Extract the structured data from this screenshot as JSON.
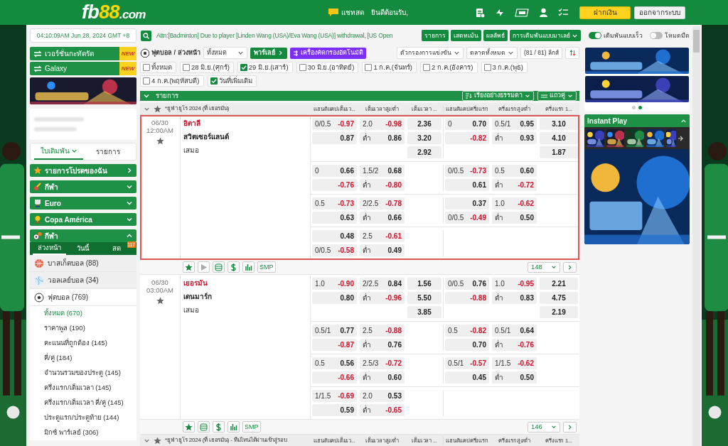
{
  "header": {
    "logo": [
      "fb",
      "88",
      ".com"
    ],
    "chat": "แชทสด",
    "welcome": "ยินดีต้อนรับ,",
    "buttons": [
      {
        "label": "ฝากเงิน",
        "kind": "primary"
      },
      {
        "label": "ออกจากระบบ",
        "kind": "secondary"
      }
    ]
  },
  "top_bar": {
    "clock": "04:10:09AM Jun 28, 2024 GMT +8",
    "announcement": "Attn:[Badminton] Due to player [Linden Wang (USA)/Eva Wang (USA)] withdrawal, [US Open",
    "buttons": [
      "รายการ",
      "เสตทเม้น",
      "ผลลัพธ์"
    ],
    "odds_type": "การเดิมพันแบบมาเลย์",
    "toggles": [
      {
        "label": "เดิมพันแบบเร็ว",
        "on": true
      },
      {
        "label": "โหมดมืด",
        "on": false
      }
    ]
  },
  "sidebar": {
    "versions": [
      {
        "label": "เวอร์ชั่นกะทัดรัด",
        "badge": "NEW"
      },
      {
        "label": "Galaxy",
        "badge": "NEW"
      }
    ],
    "tabs": [
      {
        "label": "ใบเดิมพัน",
        "selected": true
      },
      {
        "label": "รายการ",
        "selected": false
      }
    ],
    "sections": [
      {
        "label": "รายการโปรดของฉัน",
        "kind": "favorites"
      },
      {
        "label": "กีฬา",
        "kind": "sports",
        "expanded": false
      },
      {
        "label": "Euro",
        "kind": "euro",
        "expanded": false
      },
      {
        "label": "Copa América",
        "kind": "copa",
        "expanded": false
      },
      {
        "label": "กีฬา",
        "kind": "balls",
        "expanded": true
      }
    ],
    "sport_tabs": [
      {
        "label": "ล่วงหน้า",
        "selected": true
      },
      {
        "label": "วันนี้",
        "selected": false
      },
      {
        "label": "สด",
        "selected": false,
        "badge": "117"
      }
    ],
    "sports": [
      {
        "name": "บาสเก็ตบอล",
        "count": "(88)",
        "kind": "basketball",
        "expanded": false
      },
      {
        "name": "วอลเลย์บอล",
        "count": "(34)",
        "kind": "volleyball",
        "expanded": false
      },
      {
        "name": "ฟุตบอล",
        "count": "(769)",
        "kind": "soccer",
        "expanded": true,
        "children": [
          {
            "label": "ทั้งหมด",
            "count": "(670)",
            "selected": true
          },
          {
            "label": "ราคาพูล",
            "count": "(190)",
            "selected": false
          },
          {
            "label": "คะแนนที่ถูกต้อง",
            "count": "(145)",
            "selected": false
          },
          {
            "label": "คี่/คู่",
            "count": "(184)",
            "selected": false
          },
          {
            "label": "จำนวนรวมของประตู",
            "count": "(145)",
            "selected": false
          },
          {
            "label": "ครึ่งแรก/เต็มเวลา",
            "count": "(145)",
            "selected": false
          },
          {
            "label": "ครึ่งแรก/เต็มเวลา คี่/คู่",
            "count": "(145)",
            "selected": false
          },
          {
            "label": "ประตูแรก/ประตูท้าย",
            "count": "(144)",
            "selected": false
          },
          {
            "label": "มิกซ์ พาร์เลย์",
            "count": "(306)",
            "selected": false
          }
        ]
      }
    ]
  },
  "filters": {
    "sport": "ฟุตบอล / ล่วงหน้า",
    "select": "ทั้งหมด",
    "parlay": "พาร์เลย์",
    "auto_filter": "เครื่องคัดกรองอัตโนมัติ",
    "dropdowns": [
      "ตัวกรองการแข่งขัน",
      "ตลาดทั้งหมด"
    ],
    "league_count": "(81 / 81) ลีกส์",
    "dates": [
      {
        "label": "ทั้งหมด",
        "checked": false
      },
      {
        "label": "28 มิ.ย.(ศุกร์)",
        "checked": false
      },
      {
        "label": "29 มิ.ย.(เสาร์)",
        "checked": true
      },
      {
        "label": "30 มิ.ย.(อาทิตย์)",
        "checked": false
      },
      {
        "label": "1 ก.ค.(จันทร์)",
        "checked": false
      },
      {
        "label": "2 ก.ค.(อังคาร)",
        "checked": false
      },
      {
        "label": "3 ก.ค.(พุธ)",
        "checked": false
      },
      {
        "label": "4 ก.ค.(พฤหัสบดี)",
        "checked": false
      },
      {
        "label": "วันที่เพิ่มเติม",
        "checked": true
      }
    ]
  },
  "list_bar": {
    "title": "รายการ",
    "sort": "เรียงอย่างธรรมดา",
    "view": "แถวคู่"
  },
  "leagues": [
    {
      "name": "*ยูฟ่า ยูโร 2024 (ที่ เยอรมัน)",
      "columns": [
        "แฮนดิแคปเต็มเว...",
        "เต็มเวลาสูง/ต่ำ",
        "เต็มเวลา ...",
        "แฮนดิแคปครึ่งแรก",
        "ครึ่งแรกสูง/ต่ำ",
        "ครึ่งแรก 1..."
      ],
      "matches": [
        {
          "date": "06/30",
          "time": "12:00AM",
          "selected": true,
          "teams": [
            {
              "name": "อิตาลี",
              "kind": "favorite"
            },
            {
              "name": "สวิตเซอร์แลนด์",
              "kind": "underdog"
            },
            {
              "name": "เสมอ",
              "kind": "draw"
            }
          ],
          "groups": [
            {
              "hdp": [
                {
                  "line": "0/0.5",
                  "odds": "-0.97"
                },
                {
                  "odds": "0.87"
                }
              ],
              "ou": [
                {
                  "line": "2.0",
                  "odds": "-0.98"
                },
                {
                  "line": "ต่ำ",
                  "odds": "0.86"
                }
              ],
              "x12": [
                "2.36",
                "3.20",
                "2.92"
              ],
              "ht_hdp": [
                {
                  "line": "0",
                  "odds": "0.70"
                },
                {
                  "odds": "-0.82"
                }
              ],
              "ht_ou": [
                {
                  "line": "0.5/1",
                  "odds": "0.95"
                },
                {
                  "line": "ต่ำ",
                  "odds": "0.93"
                }
              ],
              "ht_x12": [
                "3.10",
                "4.10",
                "1.87"
              ]
            },
            {
              "hdp": [
                {
                  "line": "0",
                  "odds": "0.66"
                },
                {
                  "odds": "-0.76"
                }
              ],
              "ou": [
                {
                  "line": "1.5/2",
                  "odds": "0.68"
                },
                {
                  "line": "ต่ำ",
                  "odds": "-0.80"
                }
              ],
              "ht_hdp": [
                {
                  "line": "0/0.5",
                  "odds": "-0.73"
                },
                {
                  "odds": "0.61"
                }
              ],
              "ht_ou": [
                {
                  "line": "0.5",
                  "odds": "0.60"
                },
                {
                  "line": "ต่ำ",
                  "odds": "-0.72"
                }
              ]
            },
            {
              "hdp": [
                {
                  "line": "0.5",
                  "odds": "-0.73"
                },
                {
                  "odds": "0.63"
                }
              ],
              "ou": [
                {
                  "line": "2/2.5",
                  "odds": "-0.78"
                },
                {
                  "line": "ต่ำ",
                  "odds": "0.66"
                }
              ],
              "ht_hdp": [
                {
                  "odds": "0.37"
                },
                {
                  "line": "0/0.5",
                  "odds": "-0.49"
                }
              ],
              "ht_ou": [
                {
                  "line": "1.0",
                  "odds": "-0.62"
                },
                {
                  "line": "ต่ำ",
                  "odds": "0.50"
                }
              ]
            },
            {
              "hdp": [
                {
                  "odds": "0.48"
                },
                {
                  "line": "0/0.5",
                  "odds": "-0.58"
                }
              ],
              "ou": [
                {
                  "line": "2.5",
                  "odds": "-0.61"
                },
                {
                  "line": "ต่ำ",
                  "odds": "0.49"
                }
              ]
            }
          ],
          "tools": [
            {
              "kind": "star"
            },
            {
              "kind": "play"
            },
            {
              "kind": "list"
            },
            {
              "kind": "dollar"
            },
            {
              "kind": "chart"
            },
            {
              "kind": "smp",
              "label": "SMP"
            }
          ],
          "more_count": "148"
        },
        {
          "date": "06/30",
          "time": "03:00AM",
          "selected": false,
          "teams": [
            {
              "name": "เยอรมัน",
              "kind": "favorite"
            },
            {
              "name": "เดนมาร์ก",
              "kind": "underdog"
            },
            {
              "name": "เสมอ",
              "kind": "draw"
            }
          ],
          "groups": [
            {
              "hdp": [
                {
                  "line": "1.0",
                  "odds": "-0.90"
                },
                {
                  "odds": "0.80"
                }
              ],
              "ou": [
                {
                  "line": "2/2.5",
                  "odds": "0.84"
                },
                {
                  "line": "ต่ำ",
                  "odds": "-0.96"
                }
              ],
              "x12": [
                "1.56",
                "5.50",
                "3.85"
              ],
              "ht_hdp": [
                {
                  "line": "0/0.5",
                  "odds": "0.76"
                },
                {
                  "odds": "-0.88"
                }
              ],
              "ht_ou": [
                {
                  "line": "1.0",
                  "odds": "-0.95"
                },
                {
                  "line": "ต่ำ",
                  "odds": "0.83"
                }
              ],
              "ht_x12": [
                "2.21",
                "4.75",
                "2.19"
              ]
            },
            {
              "hdp": [
                {
                  "line": "0.5/1",
                  "odds": "0.77"
                },
                {
                  "odds": "-0.87"
                }
              ],
              "ou": [
                {
                  "line": "2.5",
                  "odds": "-0.88"
                },
                {
                  "line": "ต่ำ",
                  "odds": "0.76"
                }
              ],
              "ht_hdp": [
                {
                  "line": "0.5",
                  "odds": "-0.82"
                },
                {
                  "odds": "0.70"
                }
              ],
              "ht_ou": [
                {
                  "line": "0.5/1",
                  "odds": "0.64"
                },
                {
                  "line": "ต่ำ",
                  "odds": "-0.76"
                }
              ]
            },
            {
              "hdp": [
                {
                  "line": "0.5",
                  "odds": "0.56"
                },
                {
                  "odds": "-0.66"
                }
              ],
              "ou": [
                {
                  "line": "2.5/3",
                  "odds": "-0.72"
                },
                {
                  "line": "ต่ำ",
                  "odds": "0.60"
                }
              ],
              "ht_hdp": [
                {
                  "line": "0.5/1",
                  "odds": "-0.57"
                },
                {
                  "odds": "0.45"
                }
              ],
              "ht_ou": [
                {
                  "line": "1/1.5",
                  "odds": "-0.62"
                },
                {
                  "line": "ต่ำ",
                  "odds": "0.50"
                }
              ]
            },
            {
              "hdp": [
                {
                  "line": "1/1.5",
                  "odds": "-0.69"
                },
                {
                  "odds": "0.59"
                }
              ],
              "ou": [
                {
                  "line": "2.0",
                  "odds": "0.53"
                },
                {
                  "line": "ต่ำ",
                  "odds": "-0.65"
                }
              ]
            }
          ],
          "tools": [
            {
              "kind": "star"
            },
            {
              "kind": "list"
            },
            {
              "kind": "dollar"
            },
            {
              "kind": "chart"
            },
            {
              "kind": "smp",
              "label": "SMP"
            }
          ],
          "more_count": "146"
        }
      ]
    },
    {
      "name": "*ยูฟ่า ยูโร 2024 (ที่ เยอรมัน) - ทีมไหนได้ผ่านเข้าสู่รอบ",
      "columns": [
        "แฮนดิแคปเต็มเว...",
        "เต็มเวลาสูง/ต่ำ",
        "เต็มเวลา ...",
        "แฮนดิแคปครึ่งแรก",
        "ครึ่งแรกสูง/ต่ำ",
        "ครึ่งแรก 1..."
      ]
    }
  ],
  "right_panel": {
    "dots": [
      {
        "selected": false
      },
      {
        "selected": true
      }
    ],
    "instant_play": {
      "title": "Instant Play",
      "expanded": true
    }
  }
}
